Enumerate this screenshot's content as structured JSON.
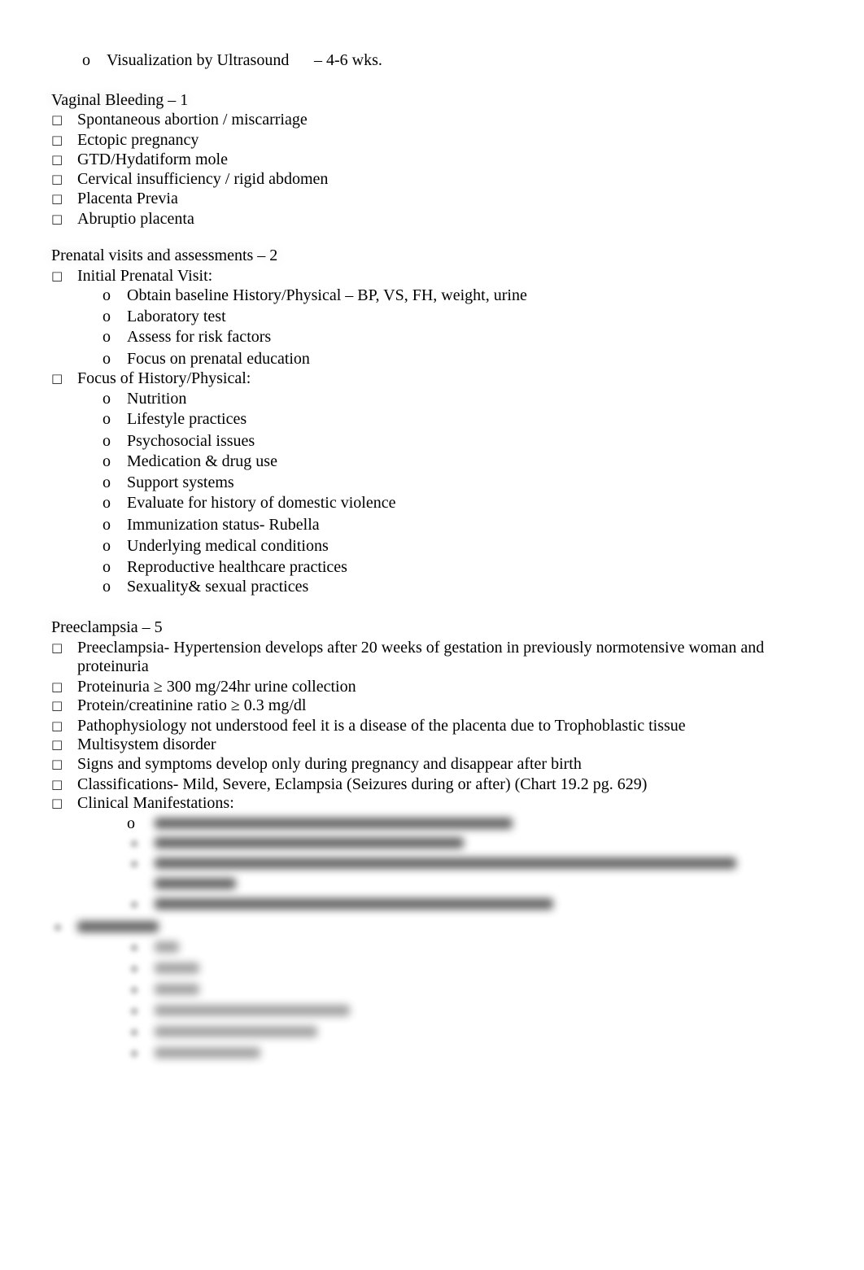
{
  "document": {
    "top_item": {
      "bullet": "o",
      "text": "Visualization by Ultrasound",
      "suffix": "– 4-6 wks."
    },
    "sections": [
      {
        "heading": "Vaginal Bleeding – 1",
        "items": [
          "Spontaneous abortion / miscarriage",
          "Ectopic pregnancy",
          "GTD/Hydatiform mole",
          "Cervical insufficiency / rigid abdomen",
          "Placenta Previa",
          "Abruptio placenta"
        ]
      },
      {
        "heading": "Prenatal visits and assessments – 2",
        "items": [
          {
            "text": "Initial Prenatal Visit:",
            "subitems": [
              "Obtain baseline History/Physical – BP, VS, FH, weight, urine",
              "Laboratory test",
              "Assess for risk factors",
              "Focus on prenatal education"
            ]
          },
          {
            "text": "Focus of History/Physical:",
            "subitems": [
              "Nutrition",
              "Lifestyle practices",
              "Psychosocial issues",
              "Medication & drug use",
              "Support systems",
              "Evaluate for history of domestic violence",
              "Immunization status- Rubella",
              "Underlying medical conditions",
              "Reproductive healthcare practices",
              "Sexuality& sexual practices"
            ]
          }
        ]
      },
      {
        "heading": "Preeclampsia – 5",
        "items": [
          "Preeclampsia- Hypertension develops after 20 weeks of gestation in previously normotensive woman and",
          "proteinuria",
          "Proteinuria ≥ 300 mg/24hr urine collection",
          "Protein/creatinine ratio ≥ 0.3 mg/dl",
          "Pathophysiology not understood feel it is a disease of the placenta due to Trophoblastic tissue",
          "Multisystem disorder",
          "Signs and symptoms develop only during pregnancy and disappear after birth",
          "Classifications- Mild, Severe, Eclampsia (Seizures during or after) (Chart 19.2 pg. 629)",
          "Clinical Manifestations:"
        ],
        "blurred_subbullet": "o"
      }
    ],
    "bullet_glyph": "",
    "sub_bullet_glyph": "o"
  }
}
